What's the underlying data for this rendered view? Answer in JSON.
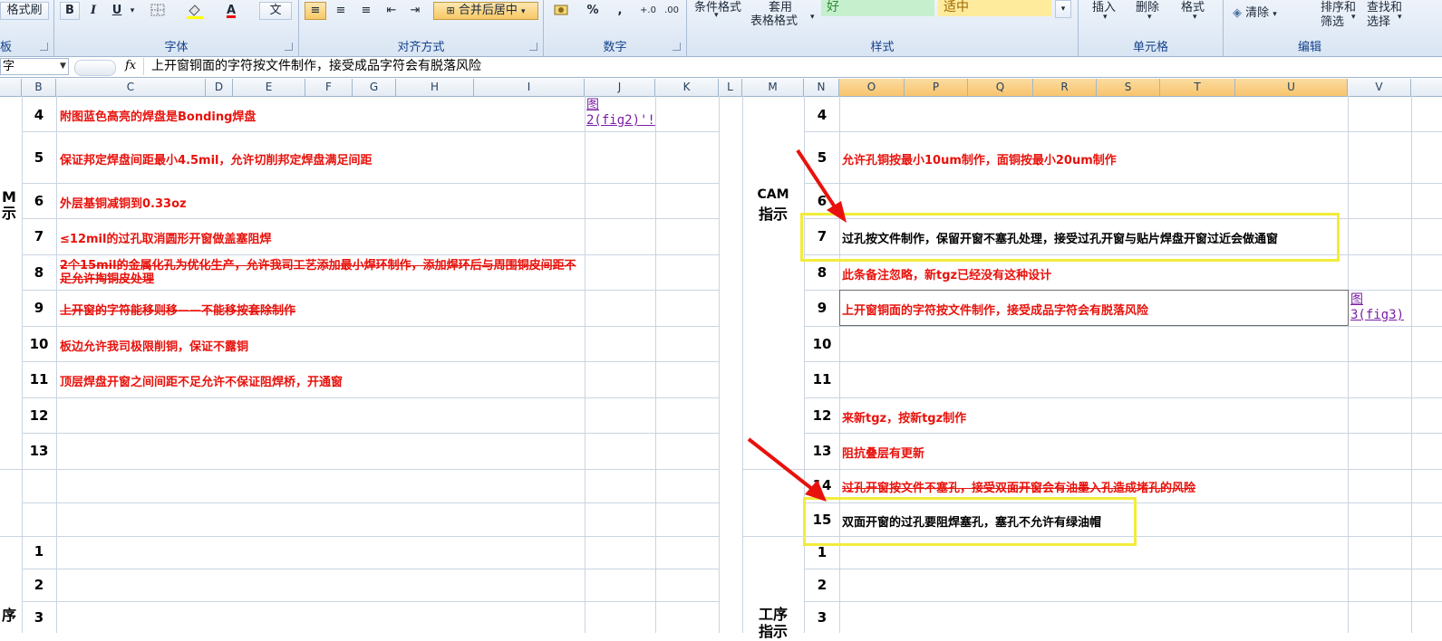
{
  "ribbon": {
    "format_painter": "格式刷",
    "bold": "B",
    "italic": "I",
    "underline": "U",
    "font_color_letter": "A",
    "wen": "文",
    "merge_center": "合并后居中",
    "percent": "%",
    "comma": ",",
    "inc_decimal": "+.0",
    "dec_decimal": ".00",
    "cond_format": "条件格式",
    "table_format_top": "套用",
    "table_format": "表格格式",
    "style_good": "好",
    "style_neutral": "适中",
    "insert": "插入",
    "delete": "删除",
    "format": "格式",
    "clear": "清除",
    "sort_filter_1": "排序和",
    "sort_filter_2": "筛选",
    "find_select_1": "查找和",
    "find_select_2": "选择",
    "groups": {
      "partial": "板",
      "font": "字体",
      "alignment": "对齐方式",
      "number": "数字",
      "styles": "样式",
      "cells": "单元格",
      "editing": "编辑"
    }
  },
  "formula_bar": {
    "name_box": "字",
    "fx": "fx",
    "content": "上开窗铜面的字符按文件制作，接受成品字符会有脱落风险"
  },
  "columns": [
    "B",
    "C",
    "D",
    "E",
    "F",
    "G",
    "H",
    "I",
    "J",
    "K",
    "L",
    "M",
    "N",
    "O",
    "P",
    "Q",
    "R",
    "S",
    "T",
    "U",
    "V"
  ],
  "left_labels": {
    "cam_1": "M",
    "cam_2": "示",
    "bottom": "序"
  },
  "right_labels": {
    "cam_1": "CAM",
    "cam_2": "指示",
    "bottom_1": "工序",
    "bottom_2": "指示"
  },
  "left_rows": [
    {
      "no": "4",
      "text": "附图蓝色高亮的焊盘是Bonding焊盘",
      "link": "图\n2(fig2)'!"
    },
    {
      "no": "5",
      "text": "保证邦定焊盘间距最小4.5mil，允许切削邦定焊盘满足间距"
    },
    {
      "no": "6",
      "text": "外层基铜减铜到0.33oz"
    },
    {
      "no": "7",
      "text": "≤12mil的过孔取消圆形开窗做盖塞阻焊"
    },
    {
      "no": "8",
      "text": "2个15mil的金属化孔为优化生产，允许我司工艺添加最小焊环制作，添加焊环后与周围铜皮间距不足允许掏铜皮处理"
    },
    {
      "no": "9",
      "text": "上开窗的字符能移则移——不能移按套除制作"
    },
    {
      "no": "10",
      "text": "板边允许我司极限削铜，保证不露铜"
    },
    {
      "no": "11",
      "text": "顶层焊盘开窗之间间距不足允许不保证阻焊桥，开通窗"
    },
    {
      "no": "12",
      "text": ""
    },
    {
      "no": "13",
      "text": ""
    },
    {
      "no": "1",
      "text": ""
    },
    {
      "no": "2",
      "text": ""
    },
    {
      "no": "3",
      "text": ""
    }
  ],
  "right_rows": [
    {
      "no": "4",
      "text": ""
    },
    {
      "no": "5",
      "text": "允许孔铜按最小10um制作，面铜按最小20um制作"
    },
    {
      "no": "6",
      "text": ""
    },
    {
      "no": "7",
      "text": "过孔按文件制作，保留开窗不塞孔处理，接受过孔开窗与贴片焊盘开窗过近会做通窗"
    },
    {
      "no": "8",
      "text": "此条备注忽略，新tgz已经没有这种设计"
    },
    {
      "no": "9",
      "text": "上开窗铜面的字符按文件制作，接受成品字符会有脱落风险",
      "link": "图\n3(fig3)"
    },
    {
      "no": "10",
      "text": ""
    },
    {
      "no": "11",
      "text": ""
    },
    {
      "no": "12",
      "text": "来新tgz，按新tgz制作"
    },
    {
      "no": "13",
      "text": "阻抗叠层有更新"
    },
    {
      "no": "14",
      "text": "过孔开窗按文件不塞孔，接受双面开窗会有油墨入孔造成堵孔的风险"
    },
    {
      "no": "15",
      "text": "双面开窗的过孔要阻焊塞孔，塞孔不允许有绿油帽"
    },
    {
      "no": "1",
      "text": ""
    },
    {
      "no": "2",
      "text": ""
    },
    {
      "no": "3",
      "text": ""
    }
  ],
  "colors": {
    "red_text": "#e8120c",
    "highlight": "#f2ec3a",
    "arrow": "#e8120c",
    "link": "#7a1ea7"
  }
}
